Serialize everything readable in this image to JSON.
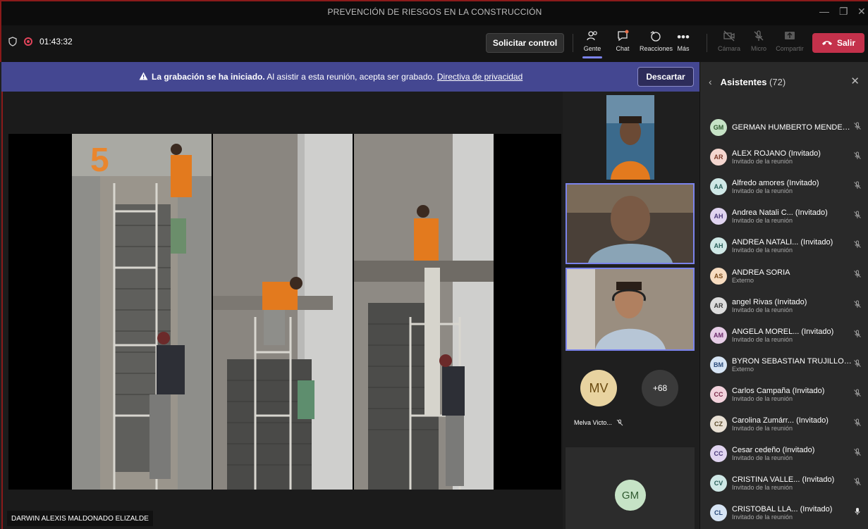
{
  "window": {
    "title": "PREVENCIÓN DE RIESGOS EN LA CONSTRUCCIÓN",
    "min": "—",
    "max": "❐",
    "close": "✕"
  },
  "toolbar": {
    "timer": "01:43:32",
    "request_control": "Solicitar control",
    "people": "Gente",
    "chat": "Chat",
    "reactions": "Reacciones",
    "more": "Más",
    "camera": "Cámara",
    "mic": "Micro",
    "share": "Compartir",
    "leave": "Salir"
  },
  "banner": {
    "bold": "La grabación se ha iniciado.",
    "text": " Al asistir a esta reunión, acepta ser grabado. ",
    "link": "Directiva de privacidad",
    "dismiss": "Descartar"
  },
  "stage": {
    "presenter": "DARWIN ALEXIS MALDONADO ELIZALDE",
    "slide_number": "5"
  },
  "tiles": {
    "mv_initials": "MV",
    "mv_name": "Melva Victo...",
    "more_count": "+68",
    "gm_initials": "GM"
  },
  "panel": {
    "title": "Asistentes",
    "count": "(72)",
    "attendees": [
      {
        "initials": "GM",
        "name": "GERMAN HUMBERTO MENDEZ ...",
        "sub": "",
        "color": "#c6e3c6",
        "fg": "#2f5a2f"
      },
      {
        "initials": "AR",
        "name": "ALEX ROJANO (Invitado)",
        "sub": "Invitado de la reunión",
        "color": "#f4d6cf",
        "fg": "#7a3a2a"
      },
      {
        "initials": "AA",
        "name": "Alfredo amores (Invitado)",
        "sub": "Invitado de la reunión",
        "color": "#cfe8e6",
        "fg": "#2a5f5a"
      },
      {
        "initials": "AH",
        "name": "Andrea Natali C... (Invitado)",
        "sub": "Invitado de la reunión",
        "color": "#e0d4f0",
        "fg": "#4a3a7a"
      },
      {
        "initials": "AH",
        "name": "ANDREA NATALI... (Invitado)",
        "sub": "Invitado de la reunión",
        "color": "#cfe8e6",
        "fg": "#2a5f5a"
      },
      {
        "initials": "AS",
        "name": "ANDREA SORIA",
        "sub": "Externo",
        "color": "#f7dcc0",
        "fg": "#7a4a1a"
      },
      {
        "initials": "AR",
        "name": "angel Rivas (Invitado)",
        "sub": "Invitado de la reunión",
        "color": "#dcdcdc",
        "fg": "#3a3a3a"
      },
      {
        "initials": "AM",
        "name": "ANGELA MOREL... (Invitado)",
        "sub": "Invitado de la reunión",
        "color": "#e6cde6",
        "fg": "#6a2a6a"
      },
      {
        "initials": "BM",
        "name": "BYRON SEBASTIAN TRUJILLO M...",
        "sub": "Externo",
        "color": "#d6e4f4",
        "fg": "#2a4a7a"
      },
      {
        "initials": "CC",
        "name": "Carlos Campaña (Invitado)",
        "sub": "Invitado de la reunión",
        "color": "#f2d2dc",
        "fg": "#7a2a4a"
      },
      {
        "initials": "CZ",
        "name": "Carolina Zumárr... (Invitado)",
        "sub": "Invitado de la reunión",
        "color": "#e8e0d4",
        "fg": "#5a4a2a"
      },
      {
        "initials": "CC",
        "name": "Cesar cedeño (Invitado)",
        "sub": "Invitado de la reunión",
        "color": "#e0d4f0",
        "fg": "#4a3a7a"
      },
      {
        "initials": "CV",
        "name": "CRISTINA VALLE... (Invitado)",
        "sub": "Invitado de la reunión",
        "color": "#cfe8e6",
        "fg": "#2a5f5a"
      },
      {
        "initials": "CL",
        "name": "CRISTOBAL LLA... (Invitado)",
        "sub": "Invitado de la reunión",
        "color": "#d6e4f4",
        "fg": "#2a4a7a"
      }
    ]
  },
  "colors": {
    "accent": "#7b83eb",
    "leave": "#c4314b",
    "banner": "#444791"
  }
}
